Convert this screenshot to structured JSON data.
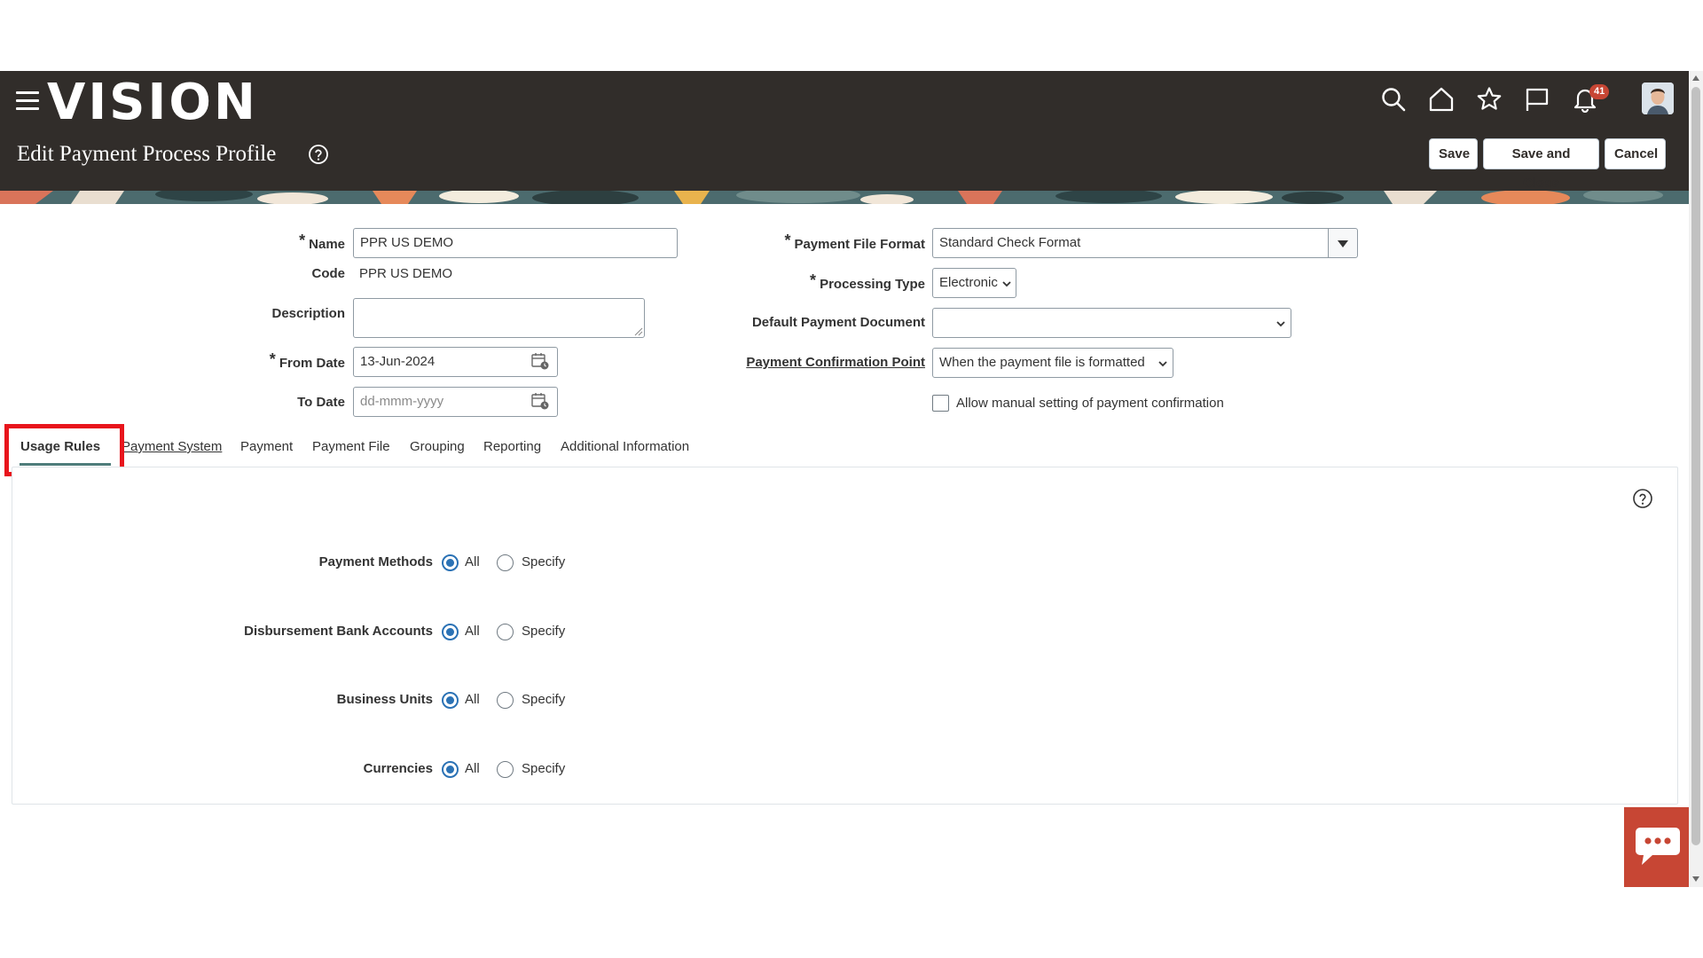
{
  "header": {
    "logo": "VISION",
    "page_title": "Edit Payment Process Profile",
    "notification_count": "41",
    "buttons": {
      "save": "Save",
      "save_close": "Save and Close",
      "cancel": "Cancel"
    },
    "icons": [
      "menu-icon",
      "search-icon",
      "home-icon",
      "star-icon",
      "flag-icon",
      "bell-icon",
      "user-avatar"
    ],
    "bg_color": "#312d2a"
  },
  "form": {
    "name_label": "Name",
    "name_value": "PPR US DEMO",
    "code_label": "Code",
    "code_value": "PPR US DEMO",
    "description_label": "Description",
    "description_value": "",
    "from_date_label": "From Date",
    "from_date_value": "13-Jun-2024",
    "to_date_label": "To Date",
    "to_date_placeholder": "dd-mmm-yyyy",
    "payment_file_format_label": "Payment File Format",
    "payment_file_format_value": "Standard Check Format",
    "processing_type_label": "Processing Type",
    "processing_type_value": "Electronic",
    "default_payment_doc_label": "Default Payment Document",
    "default_payment_doc_value": "",
    "payment_conf_point_label": "Payment Confirmation Point",
    "payment_conf_point_value": "When the payment file is formatted",
    "allow_manual_label": "Allow manual setting of payment confirmation",
    "required_marker": "*"
  },
  "tabs": [
    {
      "label": "Usage Rules",
      "active": true
    },
    {
      "label": "Payment System",
      "active": false
    },
    {
      "label": "Payment",
      "active": false
    },
    {
      "label": "Payment File",
      "active": false
    },
    {
      "label": "Grouping",
      "active": false
    },
    {
      "label": "Reporting",
      "active": false
    },
    {
      "label": "Additional Information",
      "active": false
    }
  ],
  "usage_rules": {
    "rows": [
      {
        "label": "Payment Methods",
        "selected": "All"
      },
      {
        "label": "Disbursement Bank Accounts",
        "selected": "All"
      },
      {
        "label": "Business Units",
        "selected": "All"
      },
      {
        "label": "Currencies",
        "selected": "All"
      }
    ],
    "option_all": "All",
    "option_specify": "Specify"
  },
  "colors": {
    "accent": "#2b72b5",
    "highlight": "#e8151c",
    "chat": "#c74634"
  }
}
